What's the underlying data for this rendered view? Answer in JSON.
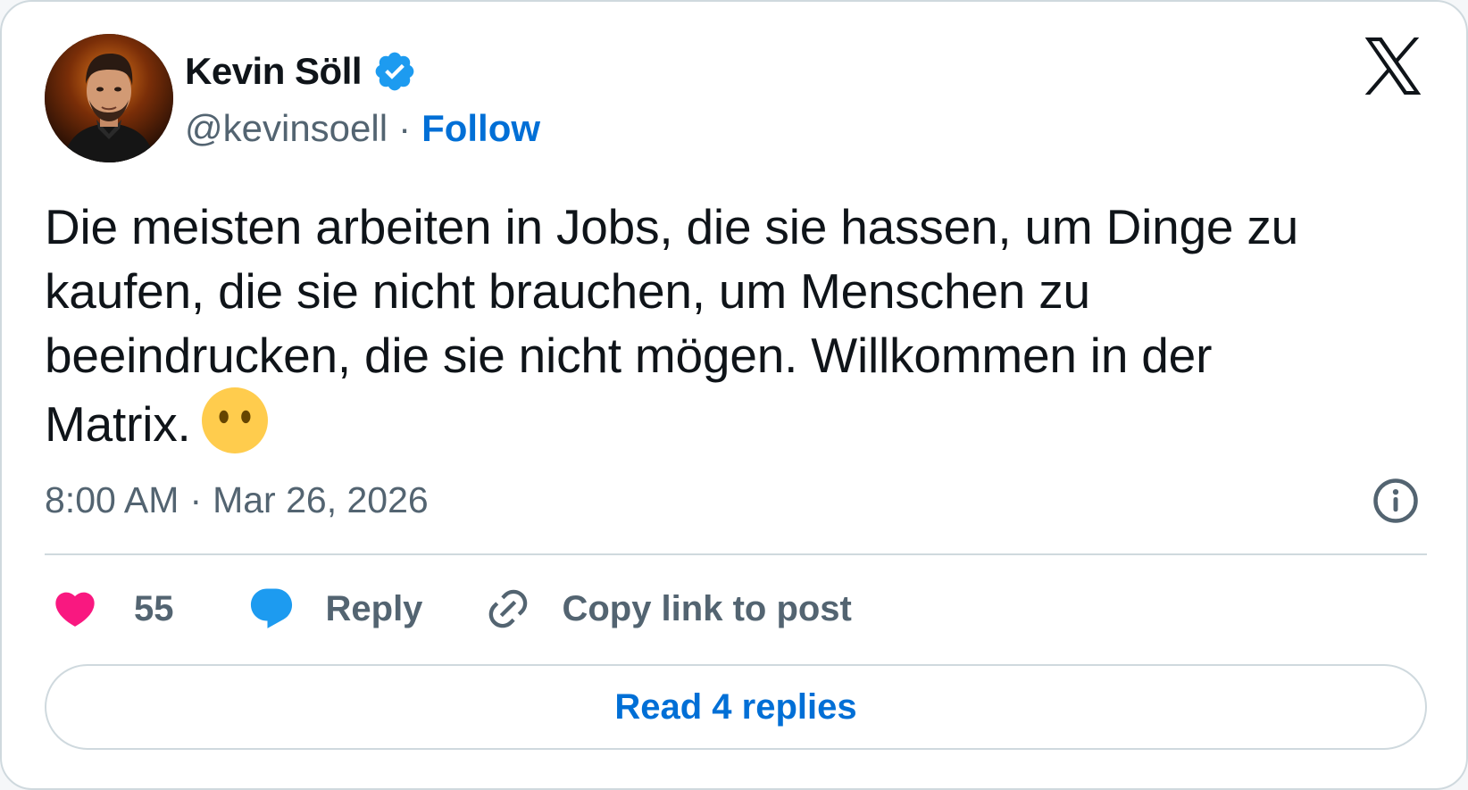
{
  "author": {
    "name": "Kevin Söll",
    "handle": "@kevinsoell",
    "separator": "·",
    "follow_label": "Follow",
    "verified": true
  },
  "tweet": {
    "text": "Die meisten arbeiten in Jobs, die sie hassen, um Dinge zu\nkaufen, die sie nicht brauchen, um Menschen zu\nbeeindrucken, die sie nicht mögen. Willkommen in der\nMatrix.",
    "emoji": "face-without-mouth",
    "time": "8:00 AM",
    "date_separator": "·",
    "date": "Mar 26, 2026"
  },
  "actions": {
    "like_count": "55",
    "reply_label": "Reply",
    "copy_label": "Copy link to post"
  },
  "read_replies_label": "Read 4 replies",
  "colors": {
    "accent": "#006fd6",
    "verified": "#1d9bf0",
    "like": "#f91880",
    "reply_icon": "#1d9bf0",
    "muted": "#536471",
    "text": "#0f1419",
    "border": "#cfd9de"
  },
  "icons": {
    "logo": "x-logo-icon",
    "verified": "verified-badge-icon",
    "info": "info-icon",
    "like": "heart-icon",
    "reply": "speech-bubble-icon",
    "copy": "link-icon"
  }
}
